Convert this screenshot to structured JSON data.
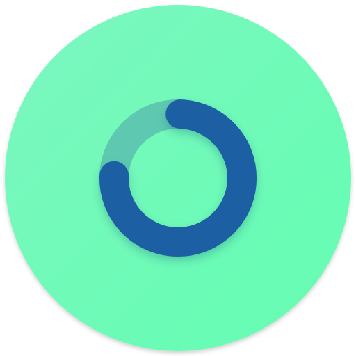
{
  "icon": {
    "name": "progress-ring-app-icon",
    "progress_fraction": 0.75,
    "colors": {
      "background_light": "#7cf7c0",
      "background_dark": "#63fdb1",
      "track": "#5ec9b0",
      "arc": "#1c5ea3",
      "arc_shadow": "#0b3e6d"
    }
  }
}
